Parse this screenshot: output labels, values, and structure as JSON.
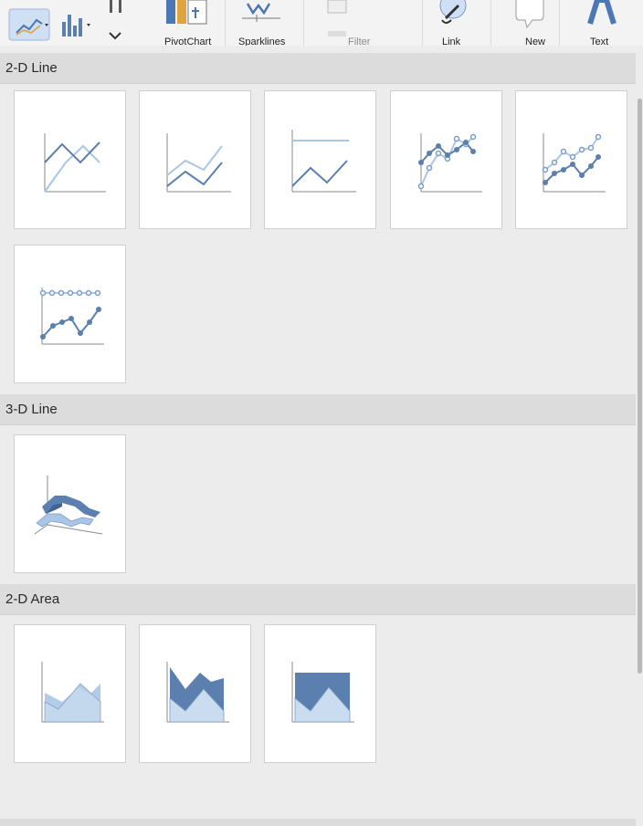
{
  "ribbon": {
    "line_chart_button": {
      "icon": "line-chart-icon",
      "selected": true
    },
    "column_chart_button": {
      "icon": "column-chart-icon"
    },
    "pivot_chart_label": "PivotChart",
    "sparklines_label": "Sparklines",
    "filter_label": "Filter",
    "link_label": "Link",
    "new_comment_label": "New",
    "text_label": "Text"
  },
  "sections": [
    {
      "title": "2-D Line",
      "items": [
        {
          "name": "Line"
        },
        {
          "name": "Stacked Line"
        },
        {
          "name": "100% Stacked Line"
        },
        {
          "name": "Line with Markers"
        },
        {
          "name": "Stacked Line with Markers"
        },
        {
          "name": "100% Stacked Line with Markers"
        }
      ]
    },
    {
      "title": "3-D Line",
      "items": [
        {
          "name": "3-D Line"
        }
      ]
    },
    {
      "title": "2-D Area",
      "items": [
        {
          "name": "Area"
        },
        {
          "name": "Stacked Area"
        },
        {
          "name": "100% Stacked Area"
        }
      ]
    }
  ],
  "colors": {
    "dark_series": "#5b7fae",
    "light_series": "#a9c6e6",
    "axis": "#8a8a8a",
    "accent_selected": "#cfe0f5"
  }
}
